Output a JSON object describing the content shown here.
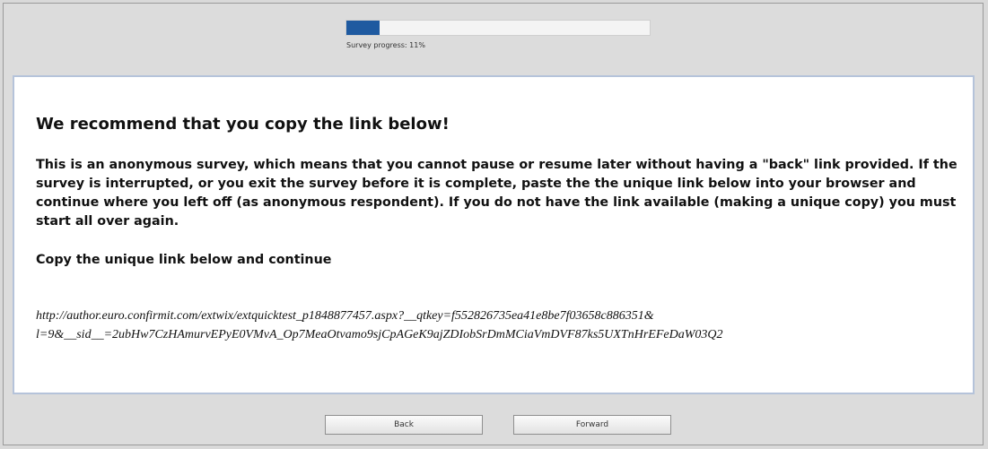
{
  "progress": {
    "fraction": 0.11,
    "label": "Survey progress: 11%",
    "fill_color": "#1f5aa0"
  },
  "message": {
    "heading": "We recommend that you copy the link below!",
    "paragraph": "This is an anonymous survey, which means that you cannot pause or resume later without having a \"back\" link provided. If the survey is interrupted, or you exit the survey before it is complete, paste the the unique link below into your browser and continue where you left off (as anonymous respondent). If you do not have the link available (making a unique copy) you must start all over again.",
    "copy_heading": "Copy the unique link below and continue",
    "link_line1": "http://author.euro.confirmit.com/extwix/extquicktest_p1848877457.aspx?__qtkey=f552826735ea41e8be7f03658c886351&",
    "link_line2": "l=9&__sid__=2ubHw7CzHAmurvEPyE0VMvA_Op7MeaOtvamo9sjCpAGeK9ajZDIobSrDmMCiaVmDVF87ks5UXTnHrEFeDaW03Q2"
  },
  "navigation": {
    "back_label": "Back",
    "forward_label": "Forward"
  }
}
